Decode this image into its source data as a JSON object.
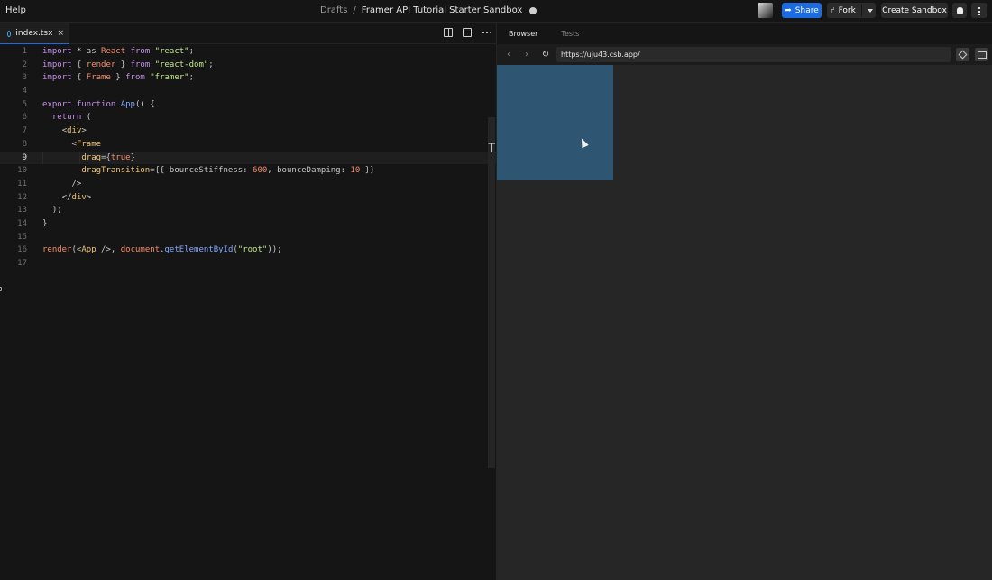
{
  "topbar": {
    "help": "Help",
    "breadcrumb_parent": "Drafts",
    "breadcrumb_sep": "/",
    "sandbox_title": "Framer API Tutorial Starter Sandbox",
    "share_label": "Share",
    "fork_label": "Fork",
    "create_label": "Create Sandbox"
  },
  "editor": {
    "tab_label": "index.tsx",
    "tab_close": "×",
    "active_line": 9,
    "line_numbers": [
      "1",
      "2",
      "3",
      "4",
      "5",
      "6",
      "7",
      "8",
      "9",
      "10",
      "11",
      "12",
      "13",
      "14",
      "15",
      "16",
      "17"
    ]
  },
  "browser": {
    "tabs": [
      "Browser",
      "Tests"
    ],
    "url": "https://uju43.csb.app/",
    "frame_color": "#2e5673"
  },
  "colors": {
    "accent": "#1a6ce0",
    "background": "#151515"
  }
}
